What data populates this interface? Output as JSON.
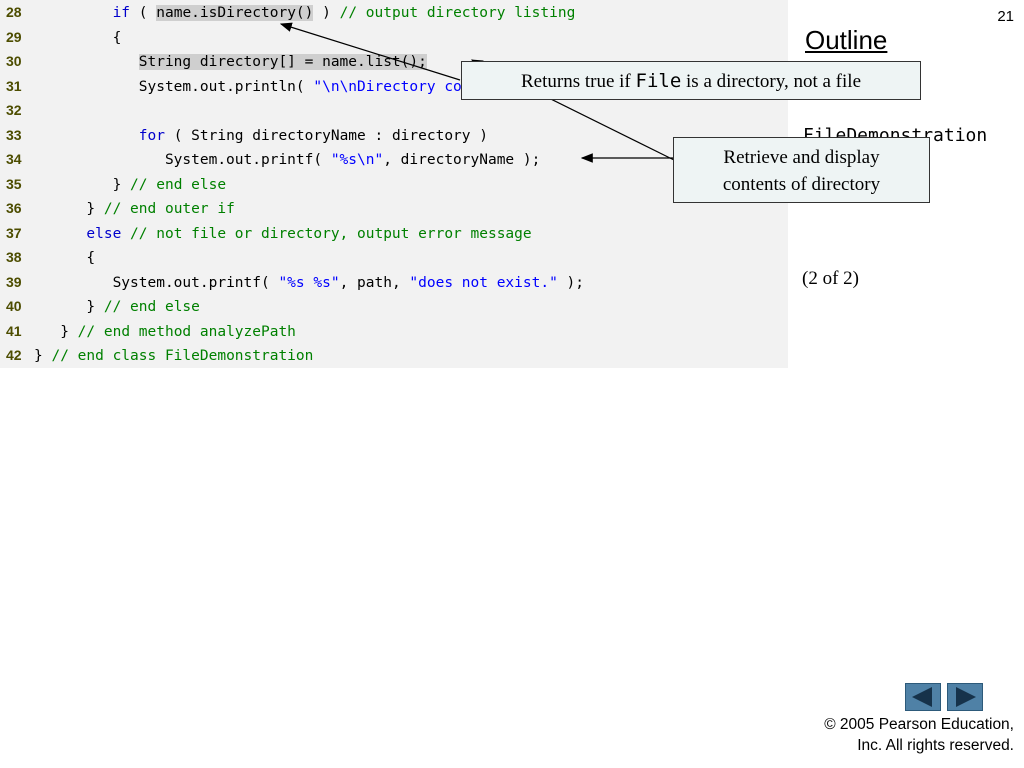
{
  "code": {
    "lines": [
      {
        "num": "28",
        "indent": "         ",
        "kw": "if",
        "p1": " ( ",
        "hl": "name.isDirectory()",
        "p2": " ) ",
        "cm": "// output directory listing"
      },
      {
        "num": "29",
        "indent": "         ",
        "text": "{"
      },
      {
        "num": "30",
        "indent": "            ",
        "hl": "String directory[] = name.list();"
      },
      {
        "num": "31",
        "indent": "            ",
        "text": "System.out.println( ",
        "st": "\"\\n\\nDirectory contents:\\n\"",
        "tail": " );"
      },
      {
        "num": "32"
      },
      {
        "num": "33",
        "indent": "            ",
        "kw": "for",
        "text": " ( String directoryName : directory )"
      },
      {
        "num": "34",
        "indent": "               ",
        "text": "System.out.printf( ",
        "st": "\"%s\\n\"",
        "tail": ", directoryName );"
      },
      {
        "num": "35",
        "indent": "         ",
        "text": "} ",
        "cm": "// end else"
      },
      {
        "num": "36",
        "indent": "      ",
        "text": "} ",
        "cm": "// end outer if"
      },
      {
        "num": "37",
        "indent": "      ",
        "kw": "else",
        "cm": " // not file or directory, output error message"
      },
      {
        "num": "38",
        "indent": "      ",
        "text": "{"
      },
      {
        "num": "39",
        "indent": "         ",
        "text": "System.out.printf( ",
        "st": "\"%s %s\"",
        "mid": ", path, ",
        "st2": "\"does not exist.\"",
        "tail": " );"
      },
      {
        "num": "40",
        "indent": "      ",
        "text": "} ",
        "cm": "// end else"
      },
      {
        "num": "41",
        "indent": "   ",
        "text": "} ",
        "cm": "// end method analyzePath"
      },
      {
        "num": "42",
        "indent": "",
        "text": "} ",
        "cm": "// end class FileDemonstration"
      }
    ]
  },
  "callouts": {
    "c1_pre": "Returns true if ",
    "c1_mono": "File",
    "c1_post": " is a directory, not a file",
    "c2_line1": "Retrieve and display",
    "c2_line2": "contents of directory"
  },
  "sidebar": {
    "slide_number": "21",
    "outline": "Outline",
    "filename": "FileDemonstration",
    "page_of": "(2 of 2)"
  },
  "nav": {
    "prev_icon": "prev-slide-icon",
    "next_icon": "next-slide-icon"
  },
  "footer": {
    "line1": "© 2005 Pearson Education,",
    "line2": "Inc.  All rights reserved."
  }
}
